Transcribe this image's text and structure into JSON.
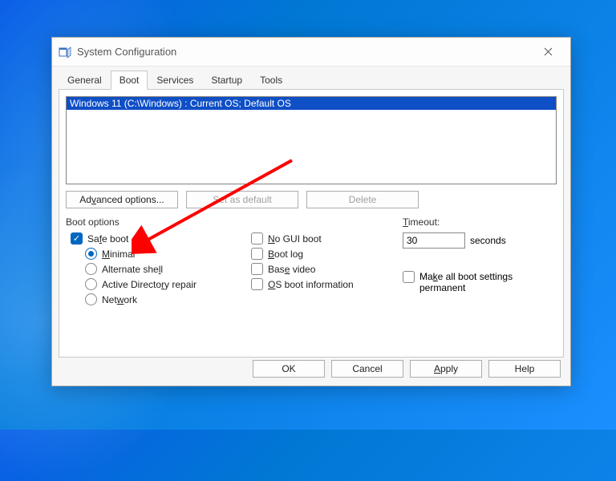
{
  "window": {
    "title": "System Configuration"
  },
  "tabs": {
    "general": "General",
    "boot": "Boot",
    "services": "Services",
    "startup": "Startup",
    "tools": "Tools",
    "active": "boot"
  },
  "osList": {
    "entry": "Windows 11 (C:\\Windows) : Current OS; Default OS"
  },
  "buttons": {
    "advanced": "Advanced options...",
    "setDefault": "Set as default",
    "delete": "Delete",
    "ok": "OK",
    "cancel": "Cancel",
    "apply": "Apply",
    "help": "Help"
  },
  "bootOptions": {
    "groupLabel": "Boot options",
    "safeboot": "Safe boot",
    "minimal": "Minimal",
    "altshell": "Alternate shell",
    "adrepair": "Active Directory repair",
    "network": "Network",
    "noguiboot": "No GUI boot",
    "bootlog": "Boot log",
    "basevideo": "Base video",
    "osbootinfo": "OS boot information"
  },
  "timeout": {
    "label": "Timeout:",
    "value": "30",
    "unit": "seconds"
  },
  "permanent": {
    "label": "Make all boot settings permanent"
  }
}
